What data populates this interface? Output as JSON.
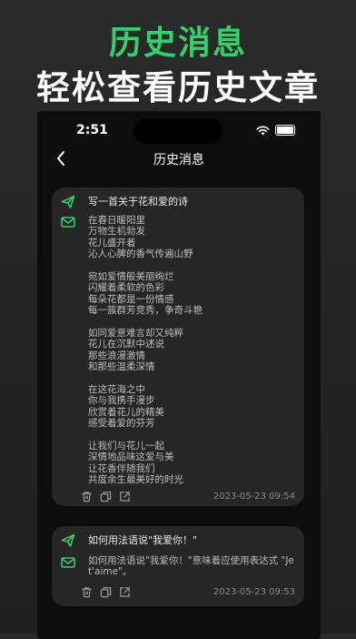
{
  "promo": {
    "title": "历史消息",
    "subtitle": "轻松查看历史文章"
  },
  "status_bar": {
    "time": "2:51"
  },
  "nav": {
    "title": "历史消息"
  },
  "colors": {
    "accent": "#2fd36a",
    "card": "#262626",
    "screen": "#0d0d0d"
  },
  "icons": {
    "back": "chevron-left-icon",
    "question": "send-icon",
    "answer": "mail-icon",
    "delete": "trash-icon",
    "copy": "copy-icon",
    "share": "share-icon"
  },
  "messages": [
    {
      "question": "写一首关于花和爱的诗",
      "answer_lines": [
        "在春日暖阳里",
        "万物生机勃发",
        "花儿盛开着",
        "沁人心脾的香气传遍山野",
        "",
        "宛如爱情般美丽绚烂",
        "闪耀着柔软的色彩",
        "每朵花都是一份情感",
        "每一簇群芳竞秀，争奇斗艳",
        "",
        "如同爱意难言却又纯粹",
        "花儿在沉默中述说",
        "那些浪漫激情",
        "和那些温柔深情",
        "",
        "在这花海之中",
        "你与我携手漫步",
        "欣赏着花儿的精美",
        "感受着爱的芬芳",
        "",
        "让我们与花儿一起",
        "深情地品味这爱与美",
        "让花香伴随我们",
        "共度余生最美好的时光"
      ],
      "timestamp": "2023-05-23 09:54"
    },
    {
      "question": "如何用法语说\"我爱你！\"",
      "answer_lines": [
        "如何用法语说\"我爱你！\"意味着应使用表达式 \"Je",
        "t'aime\"。"
      ],
      "timestamp": "2023-05-23 09:53"
    }
  ]
}
